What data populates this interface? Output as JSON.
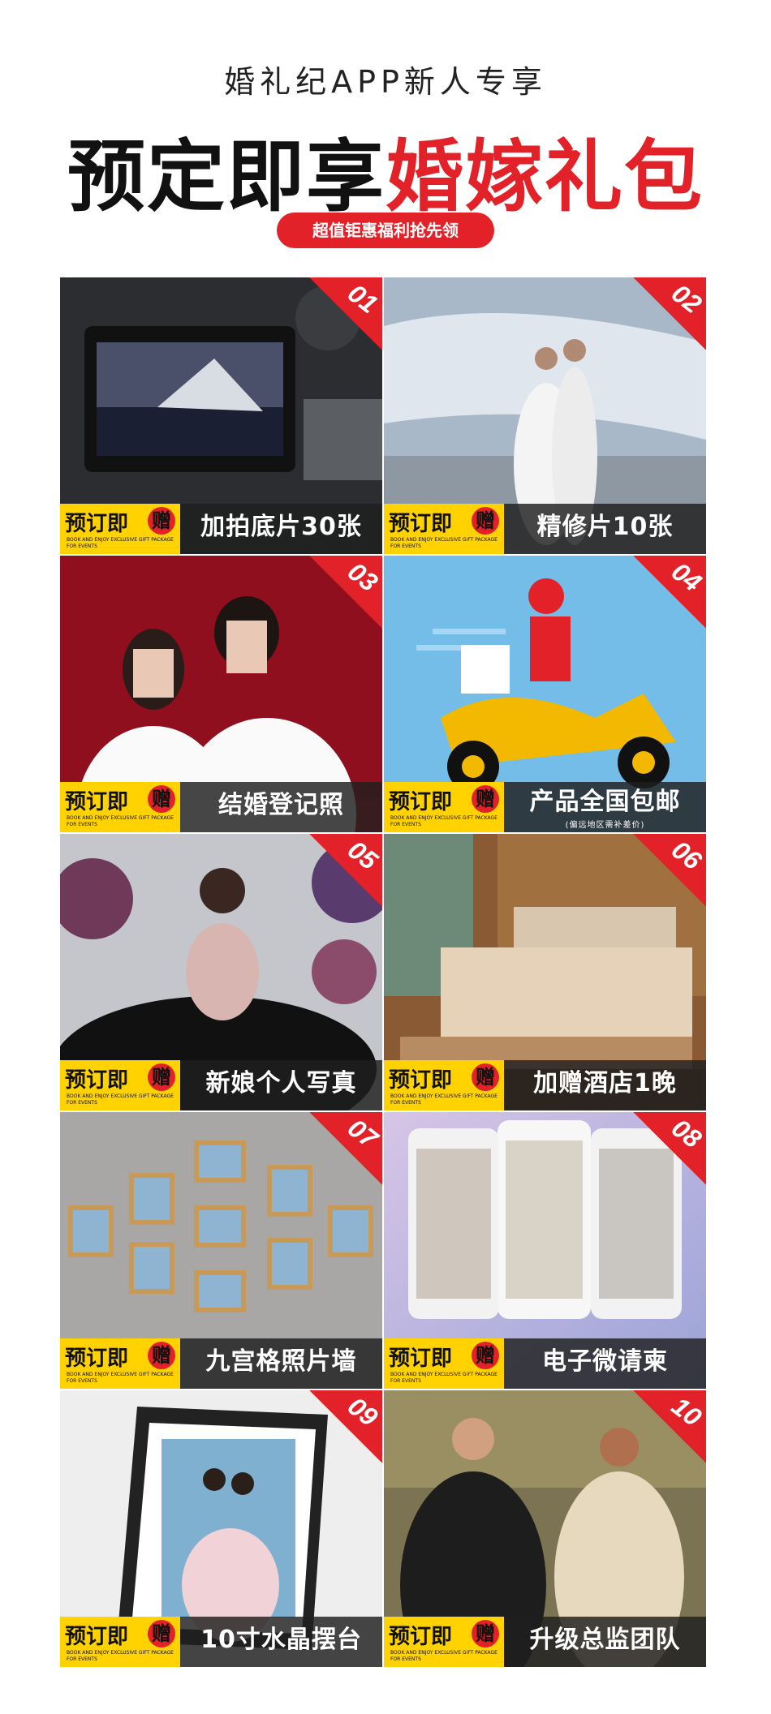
{
  "header": {
    "subtitle": "婚礼纪APP新人专享",
    "headline_black": "预定即享",
    "headline_red": "婚嫁礼包",
    "pill": "超值钜惠福利抢先领"
  },
  "badge": {
    "title": "预订即",
    "circle": "赠",
    "small": "BOOK AND ENJOY EXCLUSIVE GIFT PACKAGE FOR EVENTS"
  },
  "items": [
    {
      "num": "01",
      "label": "加拍底片30张"
    },
    {
      "num": "02",
      "label": "精修片10张"
    },
    {
      "num": "03",
      "label": "结婚登记照"
    },
    {
      "num": "04",
      "label": "产品全国包邮",
      "note": "(偏远地区需补差价)"
    },
    {
      "num": "05",
      "label": "新娘个人写真"
    },
    {
      "num": "06",
      "label": "加赠酒店1晚"
    },
    {
      "num": "07",
      "label": "九宫格照片墙"
    },
    {
      "num": "08",
      "label": "电子微请柬"
    },
    {
      "num": "09",
      "label": "10寸水晶摆台"
    },
    {
      "num": "10",
      "label": "升级总监团队"
    }
  ],
  "colors": {
    "red": "#e32128",
    "yellow": "#ffd200",
    "dark": "#1e1e1e"
  }
}
